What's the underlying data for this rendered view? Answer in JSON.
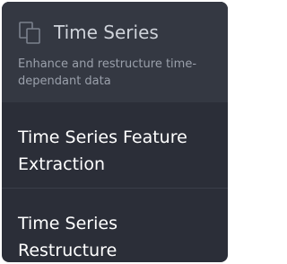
{
  "category": {
    "icon": "copy-icon",
    "title": "Time Series",
    "description": "Enhance and restructure time-dependant data"
  },
  "items": [
    {
      "label": "Time Series Feature Extraction"
    },
    {
      "label": "Time Series Restructure"
    }
  ]
}
